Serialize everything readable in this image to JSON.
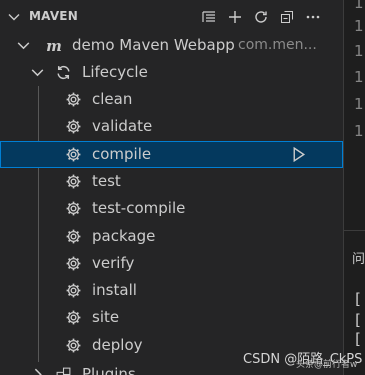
{
  "explorer": {
    "section_title": "MAVEN",
    "actions": [
      "list-flat-icon",
      "add-icon",
      "refresh-icon",
      "collapse-all-icon",
      "more-icon"
    ]
  },
  "tree": {
    "project": {
      "name": "demo Maven Webapp",
      "id": "com.men..."
    },
    "lifecycle_label": "Lifecycle",
    "goals": [
      "clean",
      "validate",
      "compile",
      "test",
      "test-compile",
      "package",
      "verify",
      "install",
      "site",
      "deploy"
    ],
    "selected_goal": "compile",
    "next_node_partial": "Plugins"
  },
  "editor": {
    "line_numbers": [
      "1",
      "1",
      "1",
      "1",
      "1",
      "1"
    ],
    "panel_tab": "问",
    "terminal_lines": [
      "[",
      "[",
      "["
    ]
  },
  "watermark": {
    "text": "CSDN @陌路_CkPS",
    "sub": "头条@前行者w"
  },
  "colors": {
    "selection": "#04395e",
    "focus_border": "#007fd4",
    "sidebar_bg": "#252526"
  }
}
